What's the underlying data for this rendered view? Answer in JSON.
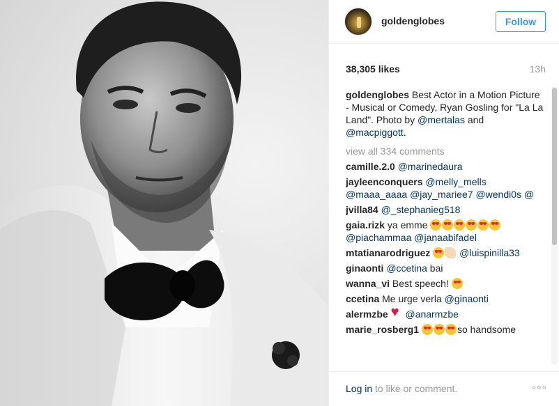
{
  "post": {
    "username": "goldenglobes",
    "follow_label": "Follow",
    "likes": "38,305 likes",
    "time": "13h"
  },
  "caption": {
    "user": "goldenglobes",
    "text_1": " Best Actor in a Motion Picture - Musical or Comedy, Ryan Gosling for \"La La Land\". Photo by ",
    "mention_1": "@mertalas",
    "text_2": " and ",
    "mention_2": "@macpiggott",
    "text_3": "."
  },
  "view_all": "view all 334 comments",
  "comments": [
    {
      "user": "camille.2.0",
      "mention": "@marinedaura"
    },
    {
      "user": "jayleenconquers",
      "m1": "@melly_mells",
      "m2": "@maaa_aaaa",
      "m3": "@jay_mariee7",
      "m4": "@wendi0s",
      "m5": "@"
    },
    {
      "user": "jvilla84",
      "mention": "@_stephanieg518"
    },
    {
      "user": "gaia.rizk",
      "text": " ya emme",
      "m1": "@piachammaa",
      "m2": "@janaabifadel"
    },
    {
      "user": "mtatianarodriguez",
      "mention": "@luispinilla33"
    },
    {
      "user": "ginaonti",
      "mention": "@ccetina",
      "text": " bai"
    },
    {
      "user": "wanna_vi",
      "text": " Best speech!"
    },
    {
      "user": "ccetina",
      "text": " Me urge verla ",
      "mention": "@ginaonti"
    },
    {
      "user": "alermzbe",
      "mention": "@anarmzbe"
    },
    {
      "user": "marie_rosberg1",
      "text": "so handsome"
    }
  ],
  "footer": {
    "login": "Log in",
    "login_rest": " to like or comment.",
    "more": "◦◦◦"
  },
  "colors": {
    "link": "#003569",
    "accent": "#3897f0",
    "muted": "#999999"
  },
  "icons": [
    "heart-eyes-emoji-icon",
    "clapping-hands-emoji-icon",
    "red-heart-emoji-icon",
    "more-options-icon"
  ]
}
